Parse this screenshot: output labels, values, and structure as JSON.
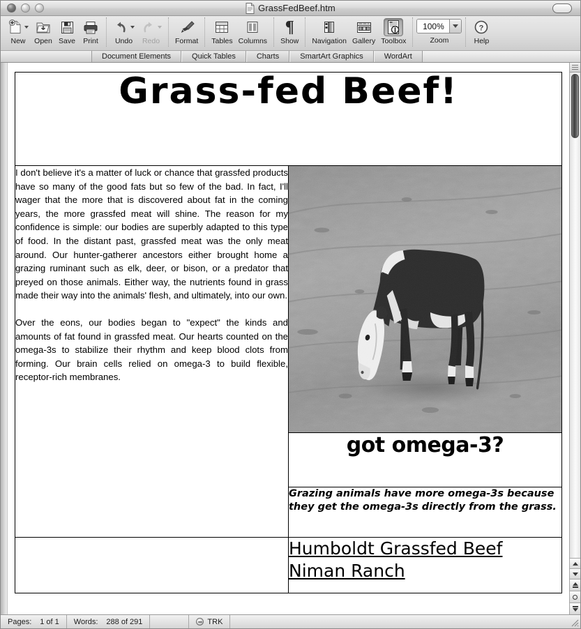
{
  "window": {
    "title": "GrassFedBeef.htm",
    "doc_icon": "document-icon",
    "controls": [
      "close-button",
      "minimize-button",
      "zoom-button"
    ],
    "right_widget": "window-resize-pill"
  },
  "toolbar": {
    "items": [
      {
        "label": "New",
        "icon": "new-document-icon",
        "has_menu": true,
        "enabled": true,
        "pressed": false
      },
      {
        "label": "Open",
        "icon": "open-folder-icon",
        "has_menu": false,
        "enabled": true,
        "pressed": false
      },
      {
        "label": "Save",
        "icon": "floppy-disk-icon",
        "has_menu": false,
        "enabled": true,
        "pressed": false
      },
      {
        "label": "Print",
        "icon": "printer-icon",
        "has_menu": false,
        "enabled": true,
        "pressed": false
      },
      {
        "label": "Undo",
        "icon": "undo-arrow-icon",
        "has_menu": true,
        "enabled": true,
        "pressed": false
      },
      {
        "label": "Redo",
        "icon": "redo-arrow-icon",
        "has_menu": true,
        "enabled": false,
        "pressed": false
      },
      {
        "label": "Format",
        "icon": "paintbrush-icon",
        "has_menu": false,
        "enabled": true,
        "pressed": false
      },
      {
        "label": "Tables",
        "icon": "table-grid-icon",
        "has_menu": false,
        "enabled": true,
        "pressed": false
      },
      {
        "label": "Columns",
        "icon": "columns-icon",
        "has_menu": false,
        "enabled": true,
        "pressed": false
      },
      {
        "label": "Show",
        "icon": "pilcrow-icon",
        "has_menu": false,
        "enabled": true,
        "pressed": false
      },
      {
        "label": "Navigation",
        "icon": "navigation-pane-icon",
        "has_menu": false,
        "enabled": true,
        "pressed": false
      },
      {
        "label": "Gallery",
        "icon": "gallery-icon",
        "has_menu": false,
        "enabled": true,
        "pressed": false
      },
      {
        "label": "Toolbox",
        "icon": "toolbox-icon",
        "has_menu": false,
        "enabled": true,
        "pressed": true
      }
    ],
    "zoom": {
      "label": "Zoom",
      "value": "100%",
      "dropdown_icon": "chevron-down-icon"
    },
    "help": {
      "label": "Help",
      "icon": "question-mark-circle-icon"
    }
  },
  "ribbon": {
    "tabs": [
      {
        "label": "Document Elements",
        "selected": false
      },
      {
        "label": "Quick Tables",
        "selected": false
      },
      {
        "label": "Charts",
        "selected": false
      },
      {
        "label": "SmartArt Graphics",
        "selected": false
      },
      {
        "label": "WordArt",
        "selected": false
      }
    ]
  },
  "document": {
    "headline": "Grass-fed Beef!",
    "body_paragraphs": [
      "I don't believe it's a matter of luck or chance that grassfed products have so many of the good fats but so few of the bad. In fact, I'll wager that the more that is discovered about fat in the coming years, the more grassfed meat will shine. The reason for my confidence is simple: our bodies are superbly adapted to this type of food. In the distant past, grassfed meat was the only meat around. Our hunter-gatherer ancestors either brought home a grazing ruminant such as elk, deer, or bison, or a predator that preyed on those animals. Either way, the nutrients found in grass made their way into the animals' flesh, and ultimately, into our own.",
      "Over the eons, our bodies began to \"expect\" the kinds and amounts of fat found in grassfed meat. Our hearts counted on the omega-3s to stabilize their rhythm and keep blood clots from forming. Our brain cells relied on omega-3 to build flexible, receptor-rich membranes."
    ],
    "photo": {
      "alt": "grazing-cow-photo",
      "description": "Black and white photograph of a Hereford cow grazing in a pasture"
    },
    "slogan": "got omega-3?",
    "caption": "Grazing animals have more omega-3s because they get the omega-3s directly from the grass.",
    "links": [
      "Humboldt Grassfed Beef",
      "Niman Ranch"
    ]
  },
  "statusbar": {
    "pages_label": "Pages:",
    "pages_value": "1 of 1",
    "words_label": "Words:",
    "words_value": "288 of 291",
    "track_changes_label": "TRK",
    "track_changes_icon": "track-changes-icon"
  },
  "scrollbar": {
    "split_icon": "split-pane-icon",
    "up_icon": "scroll-up-arrow-icon",
    "down_icon": "scroll-down-arrow-icon",
    "prev_page_icon": "previous-page-icon",
    "select_browse_icon": "select-browse-object-icon",
    "next_page_icon": "next-page-icon"
  }
}
